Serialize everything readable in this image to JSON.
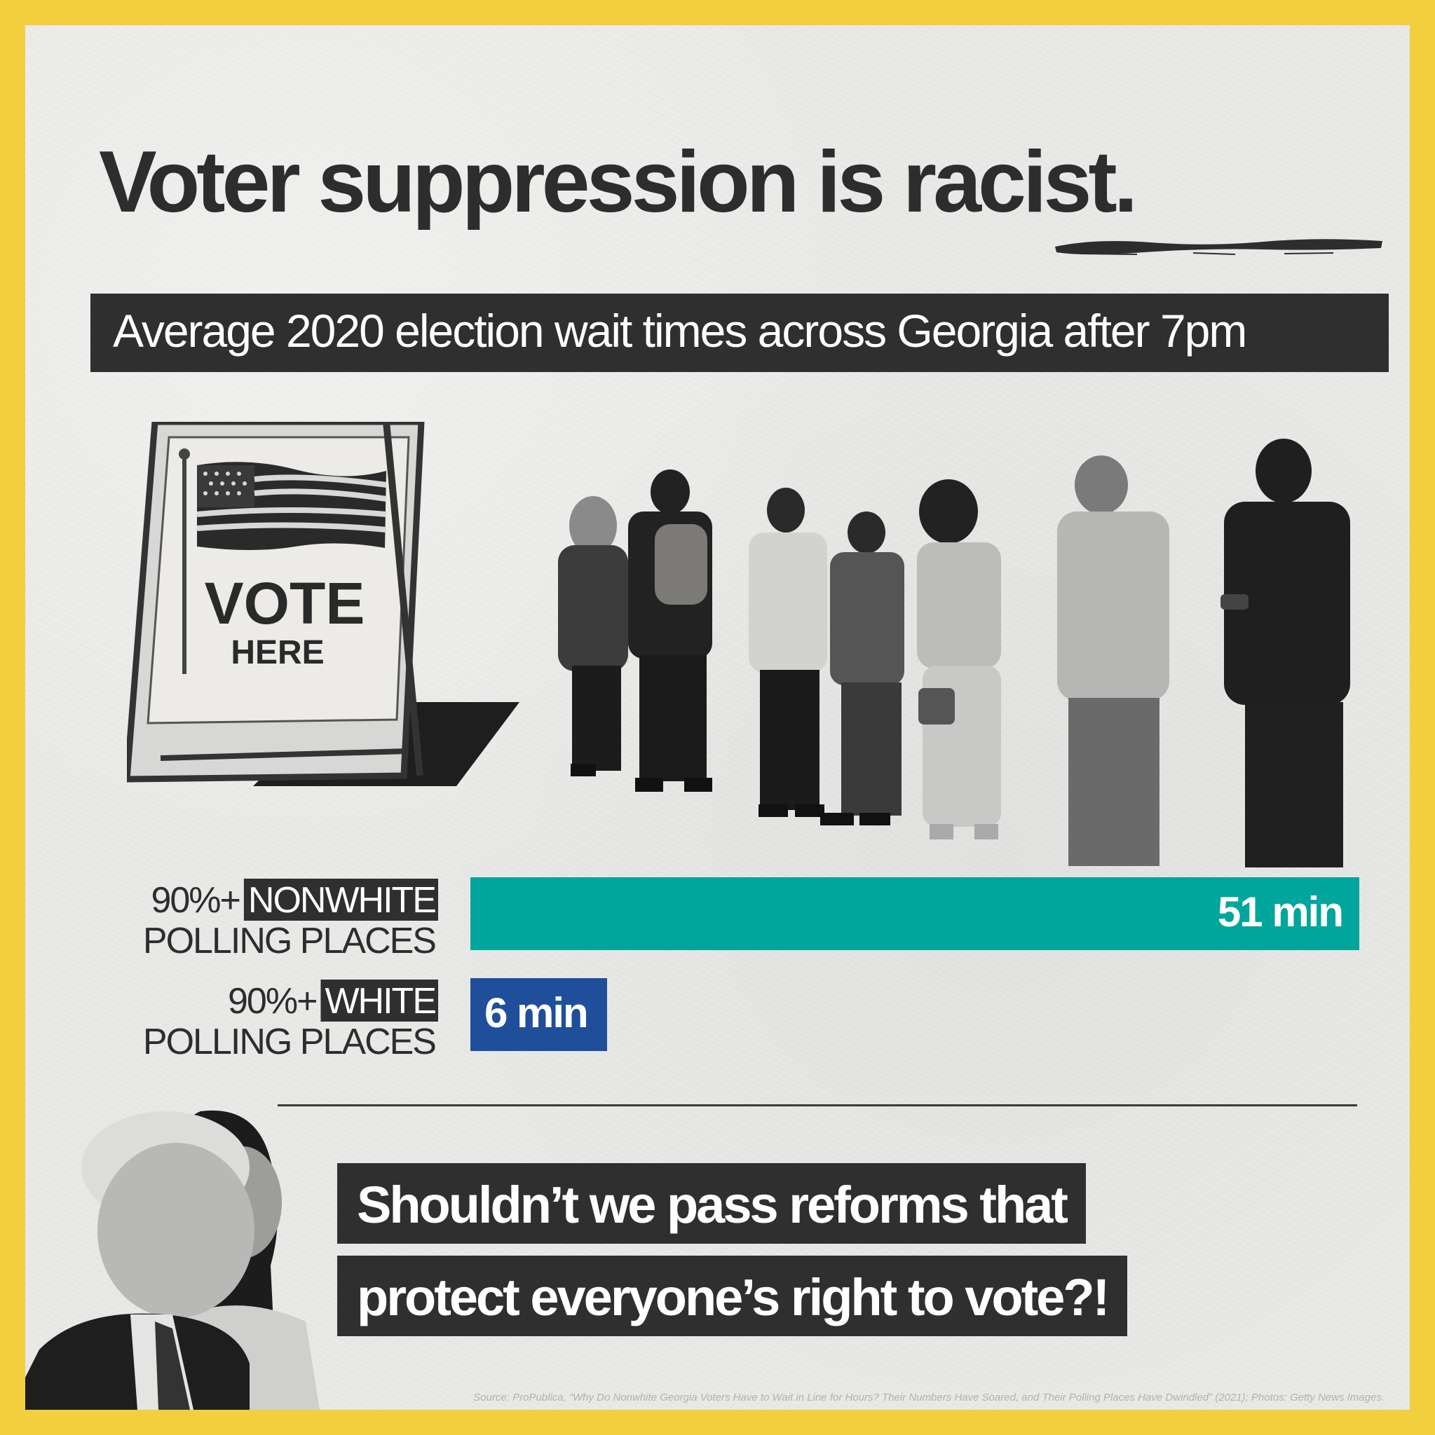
{
  "headline": "Voter suppression is racist.",
  "subtitle": "Average 2020 election wait times across Georgia after 7pm",
  "sign": {
    "line1": "VOTE",
    "line2": "HERE"
  },
  "chart_data": {
    "type": "bar",
    "orientation": "horizontal",
    "categories": [
      "90%+ NONWHITE POLLING PLACES",
      "90%+ WHITE POLLING PLACES"
    ],
    "category_labels": [
      {
        "prefix": "90%+",
        "highlight": "NONWHITE",
        "line2": "POLLING PLACES"
      },
      {
        "prefix": "90%+",
        "highlight": "WHITE",
        "line2": "POLLING PLACES"
      }
    ],
    "values": [
      51,
      6
    ],
    "data_labels": [
      "51 min",
      "6 min"
    ],
    "unit": "min",
    "colors": [
      "#00a59b",
      "#1f4f9b"
    ],
    "title": "Average 2020 election wait times across Georgia after 7pm"
  },
  "question": {
    "line1": "Shouldn’t we pass reforms that",
    "line2": "protect everyone’s right to vote?!"
  },
  "source": "Source: ProPublica, “Why Do Nonwhite Georgia Voters Have to Wait in Line for Hours? Their Numbers Have Soared, and Their Polling Places Have Dwindled” (2021); Photos: Getty News Images.",
  "colors": {
    "border": "#f1cf3f",
    "dark": "#2f2f2f",
    "paper": "#e9e9e7"
  }
}
